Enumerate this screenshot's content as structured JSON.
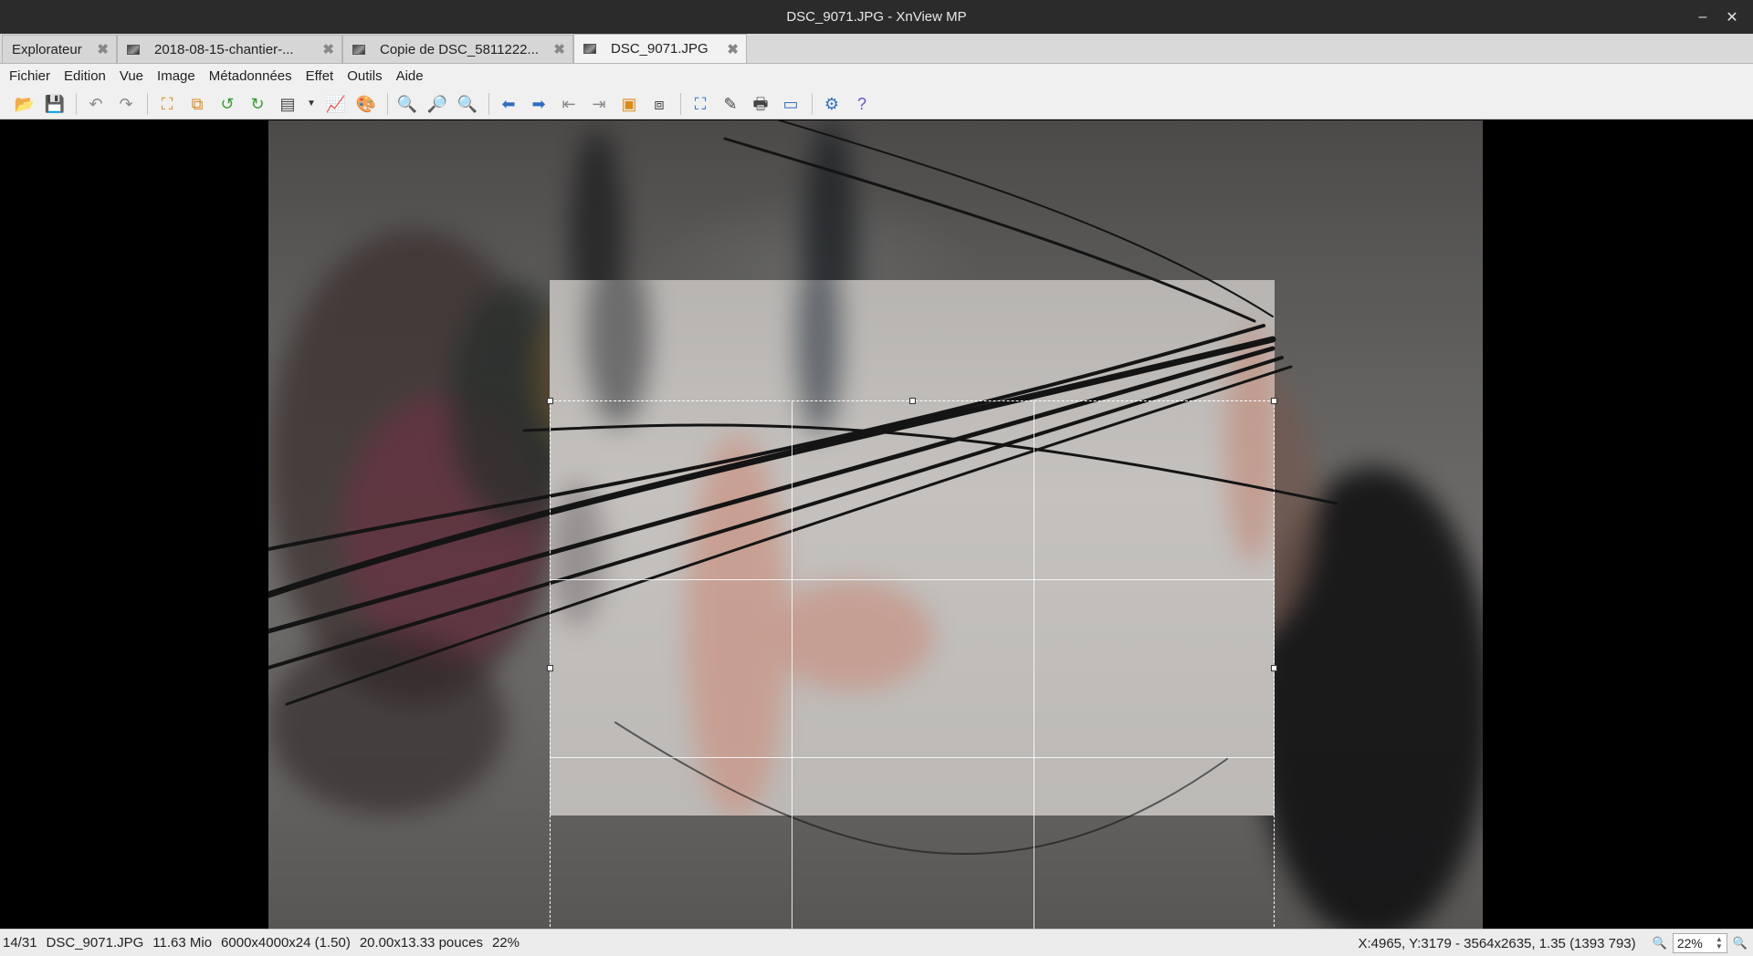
{
  "window": {
    "title": "DSC_9071.JPG - XnView MP",
    "minimize_glyph": "–",
    "close_glyph": "✕"
  },
  "tabs": [
    {
      "label": "Explorateur",
      "has_thumb": false
    },
    {
      "label": "2018-08-15-chantier-...",
      "has_thumb": true
    },
    {
      "label": "Copie de DSC_5811222...",
      "has_thumb": true
    },
    {
      "label": "DSC_9071.JPG",
      "has_thumb": true,
      "active": true
    }
  ],
  "tab_close_glyph": "✖",
  "menu": [
    "Fichier",
    "Edition",
    "Vue",
    "Image",
    "Métadonnées",
    "Effet",
    "Outils",
    "Aide"
  ],
  "toolbar": {
    "icons": [
      "open-folder-icon",
      "save-icon",
      "undo-icon",
      "redo-icon",
      "crop-icon",
      "resize-icon",
      "rotate-left-icon",
      "rotate-right-icon",
      "adjust-icon",
      "dropdown-arrow-icon",
      "levels-icon",
      "color-balance-icon",
      "zoom-in-icon",
      "zoom-fit-icon",
      "zoom-out-icon",
      "previous-icon",
      "next-icon",
      "first-icon",
      "last-icon",
      "slideshow-icon",
      "compare-icon",
      "fullscreen-icon",
      "edit-icon",
      "print-icon",
      "capture-icon",
      "settings-icon",
      "help-icon"
    ]
  },
  "viewer": {
    "image_file": "DSC_9071.JPG",
    "crop_grid": "rule-of-thirds"
  },
  "status": {
    "index": "14/31",
    "filename": "DSC_9071.JPG",
    "filesize": "11.63 Mio",
    "dimensions": "6000x4000x24 (1.50)",
    "print_size": "20.00x13.33 pouces",
    "zoom_percent": "22%",
    "coords": "X:4965, Y:3179 - 3564x2635, 1.35 (1393 793)",
    "zoom_value": "22%"
  },
  "colors": {
    "titlebar": "#2b2b2b",
    "toolbar_bg": "#f0f0f0",
    "viewer_bg": "#000000",
    "accent_blue": "#2f6fc0"
  }
}
